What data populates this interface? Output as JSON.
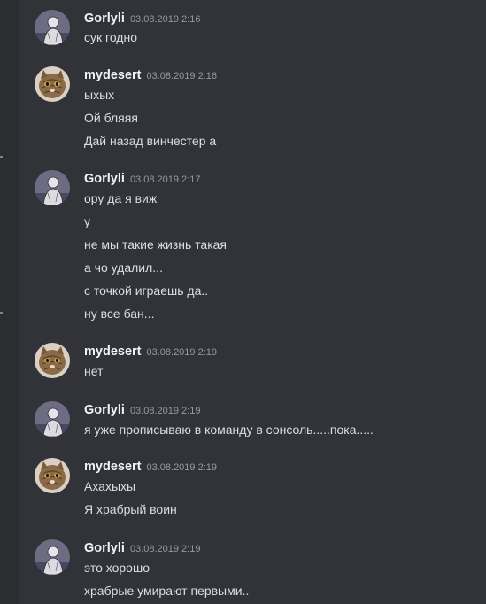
{
  "groups": [
    {
      "author": "Gorlyli",
      "avatar_icon": "sketch-figure-avatar",
      "timestamp": "03.08.2019 2:16",
      "messages": [
        "сук годно"
      ]
    },
    {
      "author": "mydesert",
      "avatar_icon": "cat-avatar",
      "timestamp": "03.08.2019 2:16",
      "messages": [
        "ыхых",
        "Ой бляяя",
        "Дай назад винчестер а"
      ]
    },
    {
      "author": "Gorlyli",
      "avatar_icon": "sketch-figure-avatar",
      "timestamp": "03.08.2019 2:17",
      "messages": [
        "ору да я виж",
        "у",
        "не мы такие жизнь такая",
        "а чо удалил...",
        "с точкой играешь да..",
        "ну все бан..."
      ]
    },
    {
      "author": "mydesert",
      "avatar_icon": "cat-avatar",
      "timestamp": "03.08.2019 2:19",
      "messages": [
        "нет"
      ]
    },
    {
      "author": "Gorlyli",
      "avatar_icon": "sketch-figure-avatar",
      "timestamp": "03.08.2019 2:19",
      "messages": [
        "я уже прописываю в команду в сонсоль.....пока....."
      ]
    },
    {
      "author": "mydesert",
      "avatar_icon": "cat-avatar",
      "timestamp": "03.08.2019 2:19",
      "messages": [
        "Ахахыхы",
        "Я храбрый воин"
      ]
    },
    {
      "author": "Gorlyli",
      "avatar_icon": "sketch-figure-avatar",
      "timestamp": "03.08.2019 2:19",
      "messages": [
        "это хорошо",
        "храбрые умирают первыми.."
      ]
    }
  ],
  "colors": {
    "background": "#313338",
    "sidebar": "#2b2d31",
    "username": "#f2f3f5",
    "timestamp": "#949ba4",
    "message_text": "#dbdee1"
  }
}
